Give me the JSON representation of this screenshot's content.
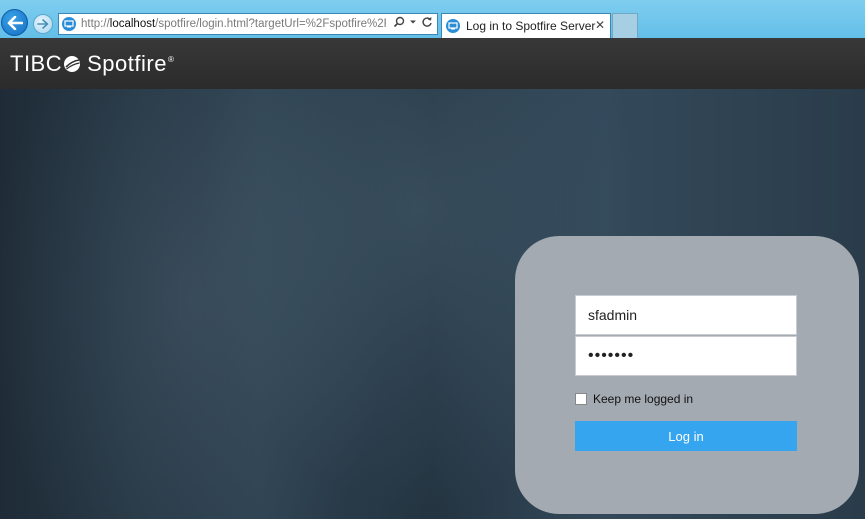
{
  "browser": {
    "url_prefix": "http://",
    "url_host": "localhost",
    "url_rest": "/spotfire/login.html?targetUrl=%2Fspotfire%2F",
    "tab_title": "Log in to Spotfire Server",
    "search_icon": "search-icon",
    "refresh_icon": "refresh-icon",
    "close_glyph": "✕"
  },
  "app": {
    "brand_part1": "TIBC",
    "brand_part2": "Spotfire",
    "brand_mark": "®"
  },
  "login": {
    "username_value": "sfadmin",
    "password_value": "•••••••",
    "remember_label": "Keep me logged in",
    "remember_checked": false,
    "submit_label": "Log in",
    "accent_color": "#35a5ef"
  }
}
